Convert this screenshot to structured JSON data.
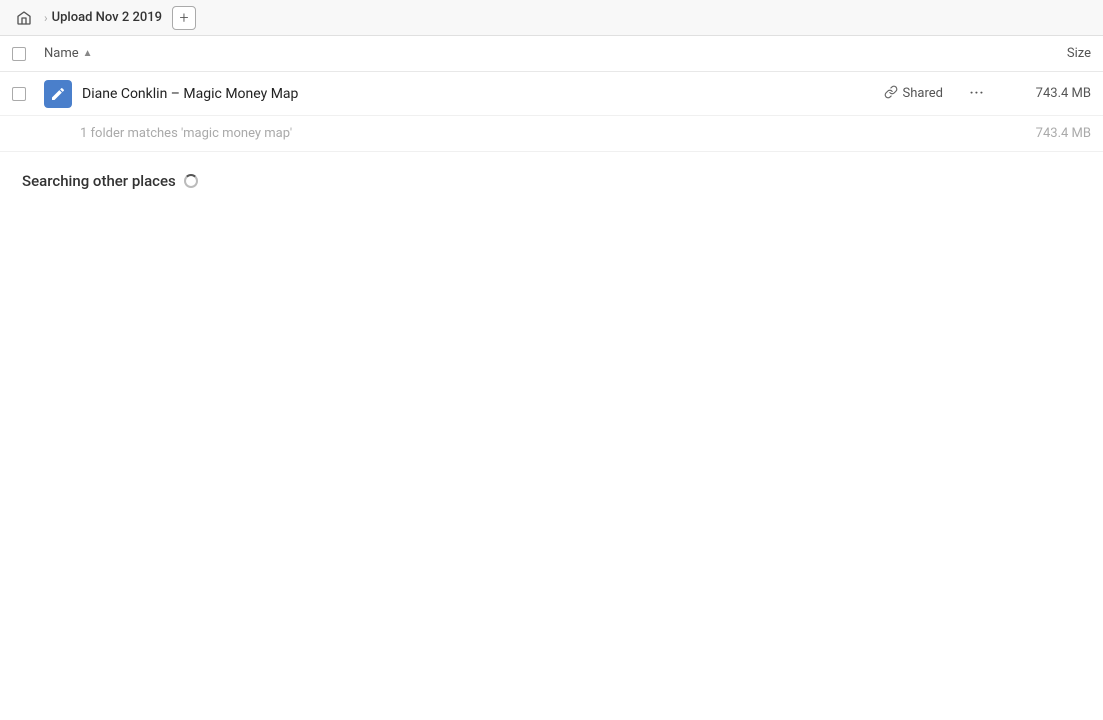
{
  "topbar": {
    "home_icon": "home-icon",
    "breadcrumb_label": "Upload Nov 2 2019",
    "add_btn_label": "+"
  },
  "column_header": {
    "name_label": "Name",
    "sort_arrow": "▲",
    "size_label": "Size"
  },
  "file_row": {
    "file_name": "Diane Conklin – Magic Money Map",
    "shared_label": "Shared",
    "more_label": "···",
    "file_size": "743.4 MB",
    "file_icon_type": "document-icon"
  },
  "sub_item": {
    "text": "1 folder matches 'magic money map'",
    "size": "743.4 MB"
  },
  "searching_section": {
    "label": "Searching other places"
  }
}
